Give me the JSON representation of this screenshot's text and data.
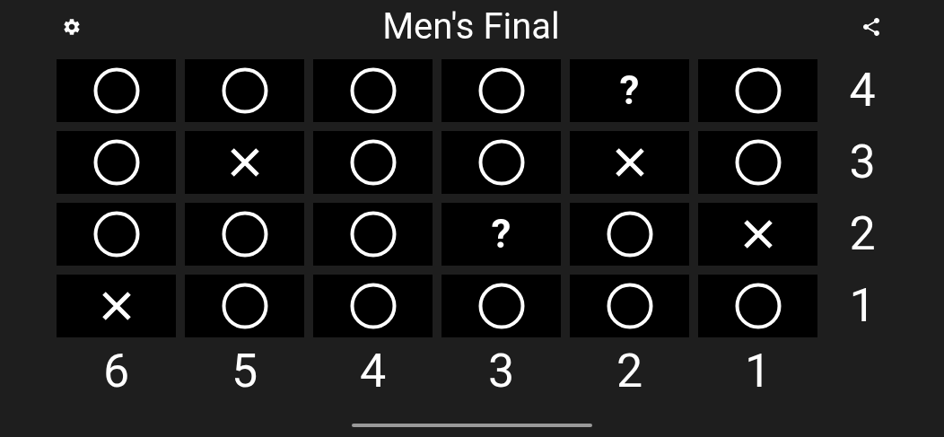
{
  "title": "Men's Final",
  "rows": [
    {
      "label": "4",
      "cells": [
        {
          "kind": "circle"
        },
        {
          "kind": "circle"
        },
        {
          "kind": "circle"
        },
        {
          "kind": "circle"
        },
        {
          "kind": "question",
          "text": "?"
        },
        {
          "kind": "circle"
        }
      ]
    },
    {
      "label": "3",
      "cells": [
        {
          "kind": "circle"
        },
        {
          "kind": "cross"
        },
        {
          "kind": "circle"
        },
        {
          "kind": "circle"
        },
        {
          "kind": "cross"
        },
        {
          "kind": "circle"
        }
      ]
    },
    {
      "label": "2",
      "cells": [
        {
          "kind": "circle"
        },
        {
          "kind": "circle"
        },
        {
          "kind": "circle"
        },
        {
          "kind": "question",
          "text": "?"
        },
        {
          "kind": "circle"
        },
        {
          "kind": "cross"
        }
      ]
    },
    {
      "label": "1",
      "cells": [
        {
          "kind": "cross"
        },
        {
          "kind": "circle"
        },
        {
          "kind": "circle"
        },
        {
          "kind": "circle"
        },
        {
          "kind": "circle"
        },
        {
          "kind": "circle"
        }
      ]
    }
  ],
  "column_labels": [
    "6",
    "5",
    "4",
    "3",
    "2",
    "1"
  ]
}
